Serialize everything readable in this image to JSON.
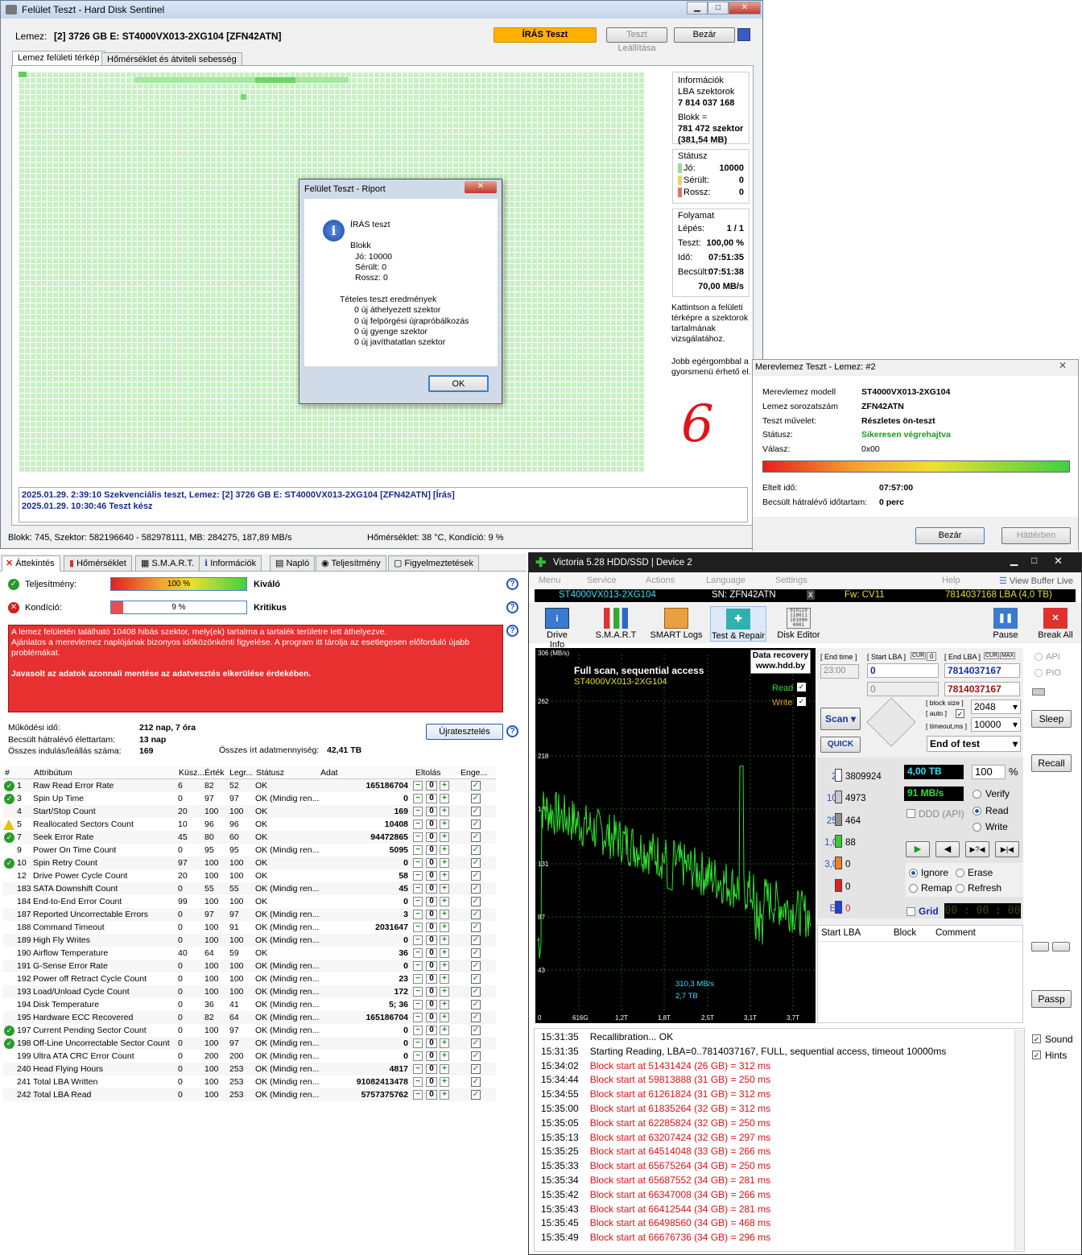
{
  "hds_window": {
    "title": "Felület Teszt - Hard Disk Sentinel",
    "disk_label": "Lemez:",
    "disk_value": "[2] 3726 GB E: ST4000VX013-2XG104 [ZFN42ATN]",
    "status_button": "ÍRÁS Teszt",
    "stop_button": "Teszt Leállítása",
    "close_button": "Bezár",
    "tabs": [
      "Lemez felületi térkép",
      "Hőmérséklet és átviteli sebesség"
    ],
    "info": {
      "header": "Információk",
      "lba_label": "LBA szektorok",
      "lba_value": "7 814 037 168",
      "block_label": "Blokk =",
      "block_value": "781 472 szektor",
      "block_mb": "(381,54 MB)"
    },
    "status": {
      "header": "Státusz",
      "good_label": "Jó:",
      "good_value": "10000",
      "damaged_label": "Sérült:",
      "damaged_value": "0",
      "bad_label": "Rossz:",
      "bad_value": "0"
    },
    "progress": {
      "header": "Folyamat",
      "step_label": "Lépés:",
      "step_value": "1 / 1",
      "test_label": "Teszt:",
      "test_value": "100,00 %",
      "time_label": "Idő:",
      "time_value": "07:51:35",
      "est_label": "Becsült:",
      "est_value": "07:51:38",
      "speed": "70,00 MB/s"
    },
    "hint1": "Kattintson a felületi térképre a szektorok tartalmának vizsgálatához.",
    "hint2": "Jobb egérgombbal a gyorsmenü érhető el.",
    "log": [
      "2025.01.29.  2:39:10   Szekvenciális teszt, Lemez: [2] 3726 GB E: ST4000VX013-2XG104 [ZFN42ATN] [Írás]",
      "2025.01.29.  10:30:46   Teszt kész"
    ],
    "statusbar_left": "Blokk: 745, Szektor: 582196640 - 582978111, MB: 284275, 187,89 MB/s",
    "statusbar_right": "Hőmérséklet: 38  °C, Kondíció: 9 %"
  },
  "dialog": {
    "title": "Felület Teszt - Riport",
    "heading": "ÍRÁS teszt",
    "block": "Blokk",
    "good": "Jó: 10000",
    "damaged": "Sérült: 0",
    "bad": "Rossz: 0",
    "results_header": "Tételes teszt eredmények",
    "r1": "0 új áthelyezett szektor",
    "r2": "0 új felpörgési újrapróbálkozás",
    "r3": "0 új gyenge szektor",
    "r4": "0 új javíthatatlan szektor",
    "ok": "OK"
  },
  "handwritten": "6",
  "hdtest": {
    "title": "Merevlemez Teszt - Lemez: #2",
    "model_label": "Merevlemez modell",
    "model_value": "ST4000VX013-2XG104",
    "serial_label": "Lemez sorozatszám",
    "serial_value": "ZFN42ATN",
    "op_label": "Teszt művelet:",
    "op_value": "Részletes ön-teszt",
    "status_label": "Státusz:",
    "status_value": "Sikeresen végrehajtva",
    "answer_label": "Válasz:",
    "answer_value": "0x00",
    "elapsed_label": "Eltelt idő:",
    "elapsed_value": "07:57:00",
    "remaining_label": "Becsült hátralévő időtartam:",
    "remaining_value": "0 perc",
    "close": "Bezár",
    "background": "Háttérben"
  },
  "overview": {
    "tabs": [
      "Áttekintés",
      "Hőmérséklet",
      "S.M.A.R.T.",
      "Információk",
      "Napló",
      "Teljesítmény",
      "Figyelmeztetések"
    ],
    "perf_label": "Teljesítmény:",
    "perf_value": "100 %",
    "perf_pct": 100,
    "perf_text": "Kiváló",
    "cond_label": "Kondíció:",
    "cond_value": "9 %",
    "cond_pct": 9,
    "cond_text": "Kritikus",
    "alert1": "A lemez felületén található 10408 hibás szektor, mely(ek) tartalma a tartalék területre lett áthelyezve.",
    "alert2": "Ajánlatos a merevlemez naplójának bizonyos időközönkénti figyelése. A program itt tárolja az esetlegesen előforduló újabb problémákat.",
    "alert3": "Javasolt az adatok azonnali mentése az adatvesztés elkerülése érdekében.",
    "uptime_label": "Működési idő:",
    "uptime_value": "212 nap, 7 óra",
    "life_label": "Becsült hátralévő élettartam:",
    "life_value": "13 nap",
    "starts_label": "Összes indulás/leállás száma:",
    "starts_value": "169",
    "written_label": "Összes írt adatmennyiség:",
    "written_value": "42,41 TB",
    "retest": "Újratesztelés",
    "smart_headers": [
      "#",
      "Attribútum",
      "Küsz...",
      "Érték",
      "Legr...",
      "Státusz",
      "Adat",
      "Eltolás",
      "Enge..."
    ],
    "smart_rows": [
      [
        "1",
        "Raw Read Error Rate",
        "6",
        "82",
        "52",
        "OK",
        "165186704",
        "ok"
      ],
      [
        "3",
        "Spin Up Time",
        "0",
        "97",
        "97",
        "OK (Mindig ren...",
        "0",
        "ok"
      ],
      [
        "4",
        "Start/Stop Count",
        "20",
        "100",
        "100",
        "OK",
        "169",
        ""
      ],
      [
        "5",
        "Reallocated Sectors Count",
        "10",
        "96",
        "96",
        "OK",
        "10408",
        "warn"
      ],
      [
        "7",
        "Seek Error Rate",
        "45",
        "80",
        "60",
        "OK",
        "94472865",
        "ok"
      ],
      [
        "9",
        "Power On Time Count",
        "0",
        "95",
        "95",
        "OK (Mindig ren...",
        "5095",
        ""
      ],
      [
        "10",
        "Spin Retry Count",
        "97",
        "100",
        "100",
        "OK",
        "0",
        "ok"
      ],
      [
        "12",
        "Drive Power Cycle Count",
        "20",
        "100",
        "100",
        "OK",
        "58",
        ""
      ],
      [
        "183",
        "SATA Downshift Count",
        "0",
        "55",
        "55",
        "OK (Mindig ren...",
        "45",
        ""
      ],
      [
        "184",
        "End-to-End Error Count",
        "99",
        "100",
        "100",
        "OK",
        "0",
        ""
      ],
      [
        "187",
        "Reported Uncorrectable Errors",
        "0",
        "97",
        "97",
        "OK (Mindig ren...",
        "3",
        ""
      ],
      [
        "188",
        "Command Timeout",
        "0",
        "100",
        "91",
        "OK (Mindig ren...",
        "2031647",
        ""
      ],
      [
        "189",
        "High Fly Writes",
        "0",
        "100",
        "100",
        "OK (Mindig ren...",
        "0",
        ""
      ],
      [
        "190",
        "Airflow Temperature",
        "40",
        "64",
        "59",
        "OK",
        "36",
        ""
      ],
      [
        "191",
        "G-Sense Error Rate",
        "0",
        "100",
        "100",
        "OK (Mindig ren...",
        "0",
        ""
      ],
      [
        "192",
        "Power off Retract Cycle Count",
        "0",
        "100",
        "100",
        "OK (Mindig ren...",
        "23",
        ""
      ],
      [
        "193",
        "Load/Unload Cycle Count",
        "0",
        "100",
        "100",
        "OK (Mindig ren...",
        "172",
        ""
      ],
      [
        "194",
        "Disk Temperature",
        "0",
        "36",
        "41",
        "OK (Mindig ren...",
        "5; 36",
        ""
      ],
      [
        "195",
        "Hardware ECC Recovered",
        "0",
        "82",
        "64",
        "OK (Mindig ren...",
        "165186704",
        ""
      ],
      [
        "197",
        "Current Pending Sector Count",
        "0",
        "100",
        "97",
        "OK (Mindig ren...",
        "0",
        "ok"
      ],
      [
        "198",
        "Off-Line Uncorrectable Sector Count",
        "0",
        "100",
        "97",
        "OK (Mindig ren...",
        "0",
        "ok"
      ],
      [
        "199",
        "Ultra ATA CRC Error Count",
        "0",
        "200",
        "200",
        "OK (Mindig ren...",
        "0",
        ""
      ],
      [
        "240",
        "Head Flying Hours",
        "0",
        "100",
        "253",
        "OK (Mindig ren...",
        "4817",
        ""
      ],
      [
        "241",
        "Total LBA Written",
        "0",
        "100",
        "253",
        "OK (Mindig ren...",
        "91082413478",
        ""
      ],
      [
        "242",
        "Total LBA Read",
        "0",
        "100",
        "253",
        "OK (Mindig ren...",
        "5757375762",
        ""
      ]
    ],
    "offset": "0"
  },
  "victoria": {
    "title": "Victoria 5.28 HDD/SSD | Device 2",
    "menu": [
      "Menu",
      "Service",
      "Actions",
      "Language",
      "Settings",
      "Help"
    ],
    "view_buffer": "View Buffer Live",
    "model": "ST4000VX013-2XG104",
    "sn": "SN: ZFN42ATN",
    "x": "x",
    "fw": "Fw: CV11",
    "lba": "7814037168 LBA (4,0 TB)",
    "toolbar": [
      "Drive Info",
      "S.M.A.R.T",
      "SMART Logs",
      "Test & Repair",
      "Disk Editor",
      "Pause",
      "Break All"
    ],
    "chart": {
      "ytop": "306 (MB/s)",
      "yticks": [
        "262",
        "218",
        "175",
        "131",
        "87",
        "43"
      ],
      "xticks": [
        "0",
        "616G",
        "1,2T",
        "1,8T",
        "2,5T",
        "3,1T",
        "3,7T"
      ],
      "title": "Full scan, sequential access",
      "model": "ST4000VX013-2XG104",
      "logo1": "Data recovery",
      "logo2": "www.hdd.by",
      "read": "Read",
      "write": "Write",
      "speed": "310,3 MB/s",
      "size": "2,7 TB"
    },
    "end_time_label": "End time",
    "start_lba_label": "Start LBA",
    "cur": "CUR",
    "zero": "0",
    "end_lba_label": "End LBA",
    "max": "MAX",
    "end_time": "23:00",
    "start_lba": "0",
    "end_lba": "7814037167",
    "start_lba2": "0",
    "end_lba2": "7814037167",
    "block_size_label": "block size",
    "auto_label": "auto",
    "block_size": "2048",
    "timeout_label": "timeout,ms",
    "timeout": "10000",
    "end_of_test": "End of test",
    "scan": "Scan",
    "quick": "QUICK",
    "counts": [
      [
        "25",
        "3809924"
      ],
      [
        "100",
        "4973"
      ],
      [
        "250",
        "464"
      ],
      [
        "1,0s",
        "88"
      ],
      [
        "3,0s",
        "0"
      ],
      [
        ">",
        "0"
      ],
      [
        "Err",
        "0"
      ]
    ],
    "size": "4,00 TB",
    "pct": "100",
    "pct_sign": "%",
    "speed": "91 MB/s",
    "ddd": "DDD (API)",
    "verify": "Verify",
    "read": "Read",
    "write": "Write",
    "ignore": "Ignore",
    "erase": "Erase",
    "remap": "Remap",
    "refresh": "Refresh",
    "grid": "Grid",
    "timer": "00 : 00 : 00",
    "table_headers": [
      "Start LBA",
      "Block",
      "Comment"
    ],
    "api": "API",
    "pio": "PIO",
    "sleep": "Sleep",
    "recall": "Recall",
    "passp": "Passp",
    "sound": "Sound",
    "hints": "Hints",
    "log": [
      [
        "15:31:35",
        "Recallibration... OK",
        "n"
      ],
      [
        "15:31:35",
        "Starting Reading, LBA=0..7814037167, FULL, sequential access, timeout 10000ms",
        "n"
      ],
      [
        "15:34:02",
        "Block start at 51431424 (26 GB)  = 312 ms",
        "r"
      ],
      [
        "15:34:44",
        "Block start at 59813888 (31 GB)  = 250 ms",
        "r"
      ],
      [
        "15:34:55",
        "Block start at 61261824 (31 GB)  = 312 ms",
        "r"
      ],
      [
        "15:35:00",
        "Block start at 61835264 (32 GB)  = 312 ms",
        "r"
      ],
      [
        "15:35:05",
        "Block start at 62285824 (32 GB)  = 250 ms",
        "r"
      ],
      [
        "15:35:13",
        "Block start at 63207424 (32 GB)  = 297 ms",
        "r"
      ],
      [
        "15:35:25",
        "Block start at 64514048 (33 GB)  = 266 ms",
        "r"
      ],
      [
        "15:35:33",
        "Block start at 65675264 (34 GB)  = 250 ms",
        "r"
      ],
      [
        "15:35:34",
        "Block start at 65687552 (34 GB)  = 281 ms",
        "r"
      ],
      [
        "15:35:42",
        "Block start at 66347008 (34 GB)  = 266 ms",
        "r"
      ],
      [
        "15:35:43",
        "Block start at 66412544 (34 GB)  = 281 ms",
        "r"
      ],
      [
        "15:35:45",
        "Block start at 66498560 (34 GB)  = 468 ms",
        "r"
      ],
      [
        "15:35:49",
        "Block start at 66676736 (34 GB)  = 296 ms",
        "r"
      ]
    ]
  }
}
